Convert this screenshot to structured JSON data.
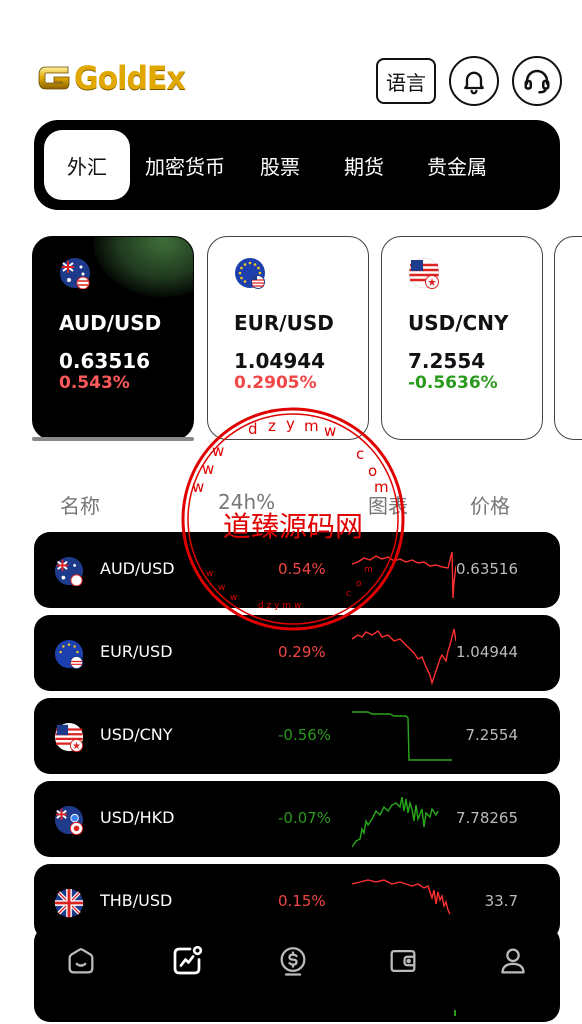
{
  "header": {
    "logo_text": "GoldEx",
    "language_button": "语言"
  },
  "tabs": [
    {
      "label": "外汇",
      "active": true
    },
    {
      "label": "加密货币",
      "active": false
    },
    {
      "label": "股票",
      "active": false
    },
    {
      "label": "期货",
      "active": false
    },
    {
      "label": "贵金属",
      "active": false
    }
  ],
  "featured": [
    {
      "flag": "aud-usd-flag-icon",
      "pair": "AUD/USD",
      "price": "0.63516",
      "change": "0.543%",
      "trend": "up"
    },
    {
      "flag": "eur-usd-flag-icon",
      "pair": "EUR/USD",
      "price": "1.04944",
      "change": "0.2905%",
      "trend": "up"
    },
    {
      "flag": "usd-cny-flag-icon",
      "pair": "USD/CNY",
      "price": "7.2554",
      "change": "-0.5636%",
      "trend": "down"
    }
  ],
  "list_header": {
    "name": "名称",
    "change": "24h%",
    "chart": "图表",
    "price": "价格"
  },
  "rows": [
    {
      "flag": "aud-usd-flag-icon",
      "pair": "AUD/USD",
      "change": "0.54%",
      "trend": "up",
      "price": "0.63516"
    },
    {
      "flag": "eur-usd-flag-icon",
      "pair": "EUR/USD",
      "change": "0.29%",
      "trend": "up",
      "price": "1.04944"
    },
    {
      "flag": "usd-cny-flag-icon",
      "pair": "USD/CNY",
      "change": "-0.56%",
      "trend": "down",
      "price": "7.2554"
    },
    {
      "flag": "usd-hkd-flag-icon",
      "pair": "USD/HKD",
      "change": "-0.07%",
      "trend": "down",
      "price": "7.78265"
    },
    {
      "flag": "thb-usd-flag-icon",
      "pair": "THB/USD",
      "change": "0.15%",
      "trend": "up",
      "price": "33.7"
    }
  ],
  "bottom_nav": [
    {
      "icon": "home-icon",
      "active": false
    },
    {
      "icon": "market-chart-icon",
      "active": true
    },
    {
      "icon": "trade-coin-icon",
      "active": false
    },
    {
      "icon": "wallet-icon",
      "active": false
    },
    {
      "icon": "profile-icon",
      "active": false
    }
  ],
  "watermark": {
    "main": "道臻源码网",
    "ring_top": "dzym",
    "ring_letters": "www.dzym.com"
  },
  "colors": {
    "up": "#f04646",
    "down": "#2a9a1c",
    "gold": "#e0a800",
    "watermark": "#e00000"
  }
}
